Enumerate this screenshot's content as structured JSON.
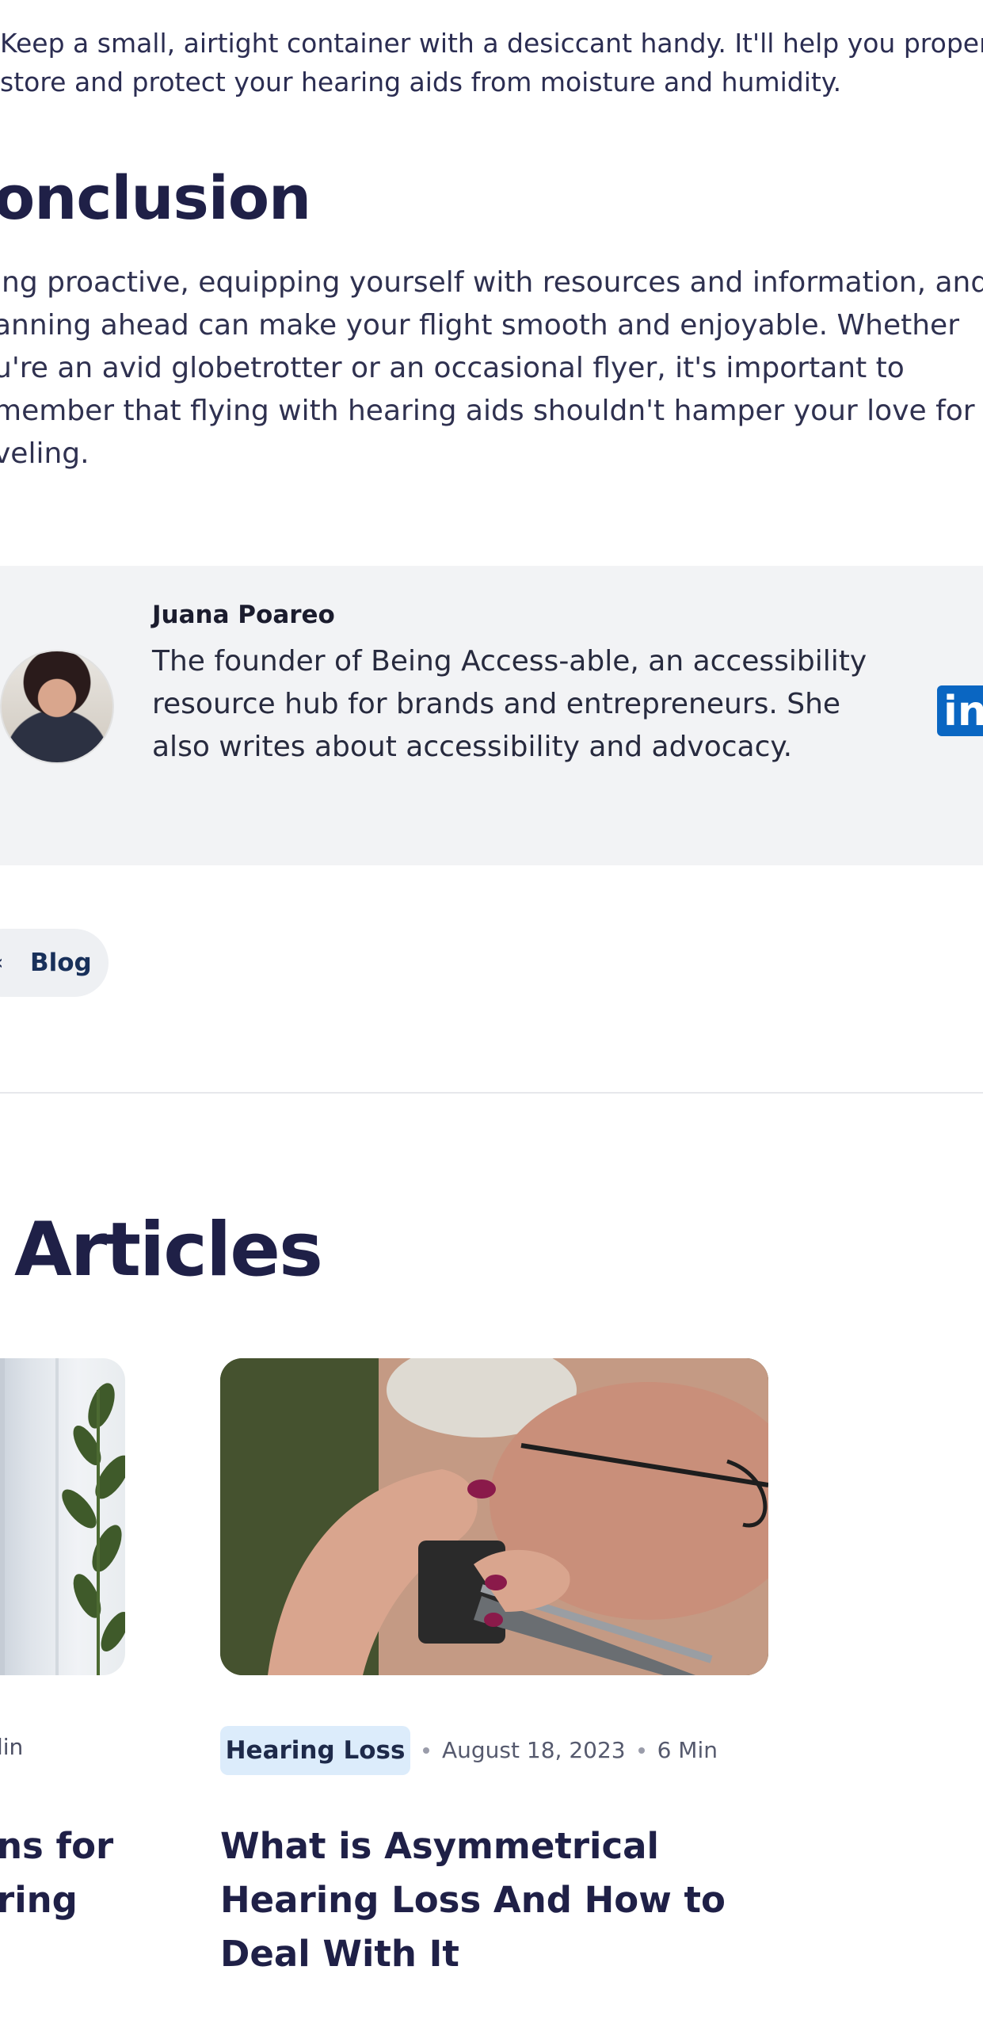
{
  "article": {
    "tip_lines": [
      "Keep a small, airtight container with a desiccant handy. It'll help you properly",
      "store and protect your hearing aids from moisture and humidity."
    ],
    "conclusion_heading": "onclusion",
    "conclusion_lines": [
      "ing proactive, equipping yourself with resources and information, and",
      "anning ahead can make your flight smooth and enjoyable. Whether",
      "u're an avid globetrotter or an occasional flyer, it's important to",
      "member that flying with hearing aids shouldn't hamper your love for",
      "veling."
    ]
  },
  "author": {
    "name": "Juana Poareo",
    "bio_lines": [
      "The founder of Being Access-able, an accessibility",
      "resource hub for brands and entrepreneurs. She",
      "also writes about accessibility and advocacy."
    ],
    "avatar_icon": "author-avatar",
    "social_icon": "linkedin-icon",
    "social_label": "in",
    "social_color": "#0a66c2"
  },
  "nav": {
    "back_icon": "chevron-left-icon",
    "back_glyph": "‹",
    "back_label": "Blog"
  },
  "related": {
    "heading": "Articles",
    "cards": [
      {
        "meta_tail": "lin",
        "title_lines": [
          "ns for",
          "ring"
        ]
      },
      {
        "tag": "Hearing Loss",
        "date": "August 18, 2023",
        "read_time": "6 Min",
        "title_lines": [
          "What is Asymmetrical",
          "Hearing Loss And How to",
          "Deal With It"
        ]
      }
    ]
  },
  "colors": {
    "heading": "#1f2047",
    "author_box_bg": "#f2f3f5",
    "tag_bg": "#dcecfb",
    "pill_bg": "#eef0f3"
  }
}
